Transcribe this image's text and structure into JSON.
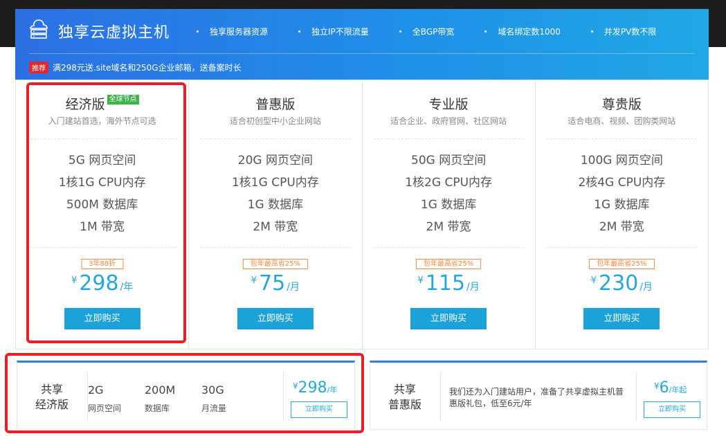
{
  "header": {
    "title": "独享云虚拟主机",
    "features": [
      "独享服务器资源",
      "独立IP不限流量",
      "全BGP带宽",
      "域名绑定数1000",
      "并发PV数不限"
    ],
    "promo_badge": "推荐",
    "promo_text": "满298元送.site域名和250G企业邮箱，送备案时长"
  },
  "plans": [
    {
      "name": "经济版",
      "badge": "全球节点",
      "desc": "入门建站首选，海外节点可选",
      "specs": [
        "5G 网页空间",
        "1核1G CPU内存",
        "500M 数据库",
        "1M 带宽"
      ],
      "discount": "3年88折",
      "currency": "¥",
      "price": "298",
      "unit": "/年",
      "button": "立即购买"
    },
    {
      "name": "普惠版",
      "badge": "",
      "desc": "适合初创型中小企业网站",
      "specs": [
        "20G 网页空间",
        "1核1G CPU内存",
        "1G 数据库",
        "2M 带宽"
      ],
      "discount": "包年最高省25%",
      "currency": "¥",
      "price": "75",
      "unit": "/月",
      "button": "立即购买"
    },
    {
      "name": "专业版",
      "badge": "",
      "desc": "适合企业、政府官网、社区网站",
      "specs": [
        "50G 网页空间",
        "1核2G CPU内存",
        "1G 数据库",
        "2M 带宽"
      ],
      "discount": "包年最高省25%",
      "currency": "¥",
      "price": "115",
      "unit": "/月",
      "button": "立即购买"
    },
    {
      "name": "尊贵版",
      "badge": "",
      "desc": "适合电商、视频、团购类网站",
      "specs": [
        "100G 网页空间",
        "2核4G CPU内存",
        "1G 数据库",
        "2M 带宽"
      ],
      "discount": "包年最高省25%",
      "currency": "¥",
      "price": "230",
      "unit": "/月",
      "button": "立即购买"
    }
  ],
  "shared_economy": {
    "name_line1": "共享",
    "name_line2": "经济版",
    "specs": [
      {
        "value": "2G",
        "label": "网页空间"
      },
      {
        "value": "200M",
        "label": "数据库"
      },
      {
        "value": "30G",
        "label": "月流量"
      }
    ],
    "currency": "¥",
    "price": "298",
    "unit": "/年",
    "button": "立即购买"
  },
  "shared_puhui": {
    "name_line1": "共享",
    "name_line2": "普惠版",
    "text": "我们还为入门建站用户，准备了共享虚拟主机普惠版礼包，低至6元/年",
    "currency": "¥",
    "price": "6",
    "unit": "/年起",
    "button": "立即购买"
  },
  "colors": {
    "header_start": "#2c6fe4",
    "header_end": "#20a8e6",
    "accent": "#1ba2d9",
    "discount": "#f08a47",
    "badge_green": "#3db44a",
    "promo_red": "#e4262f",
    "highlight_red": "#ee1c24"
  }
}
